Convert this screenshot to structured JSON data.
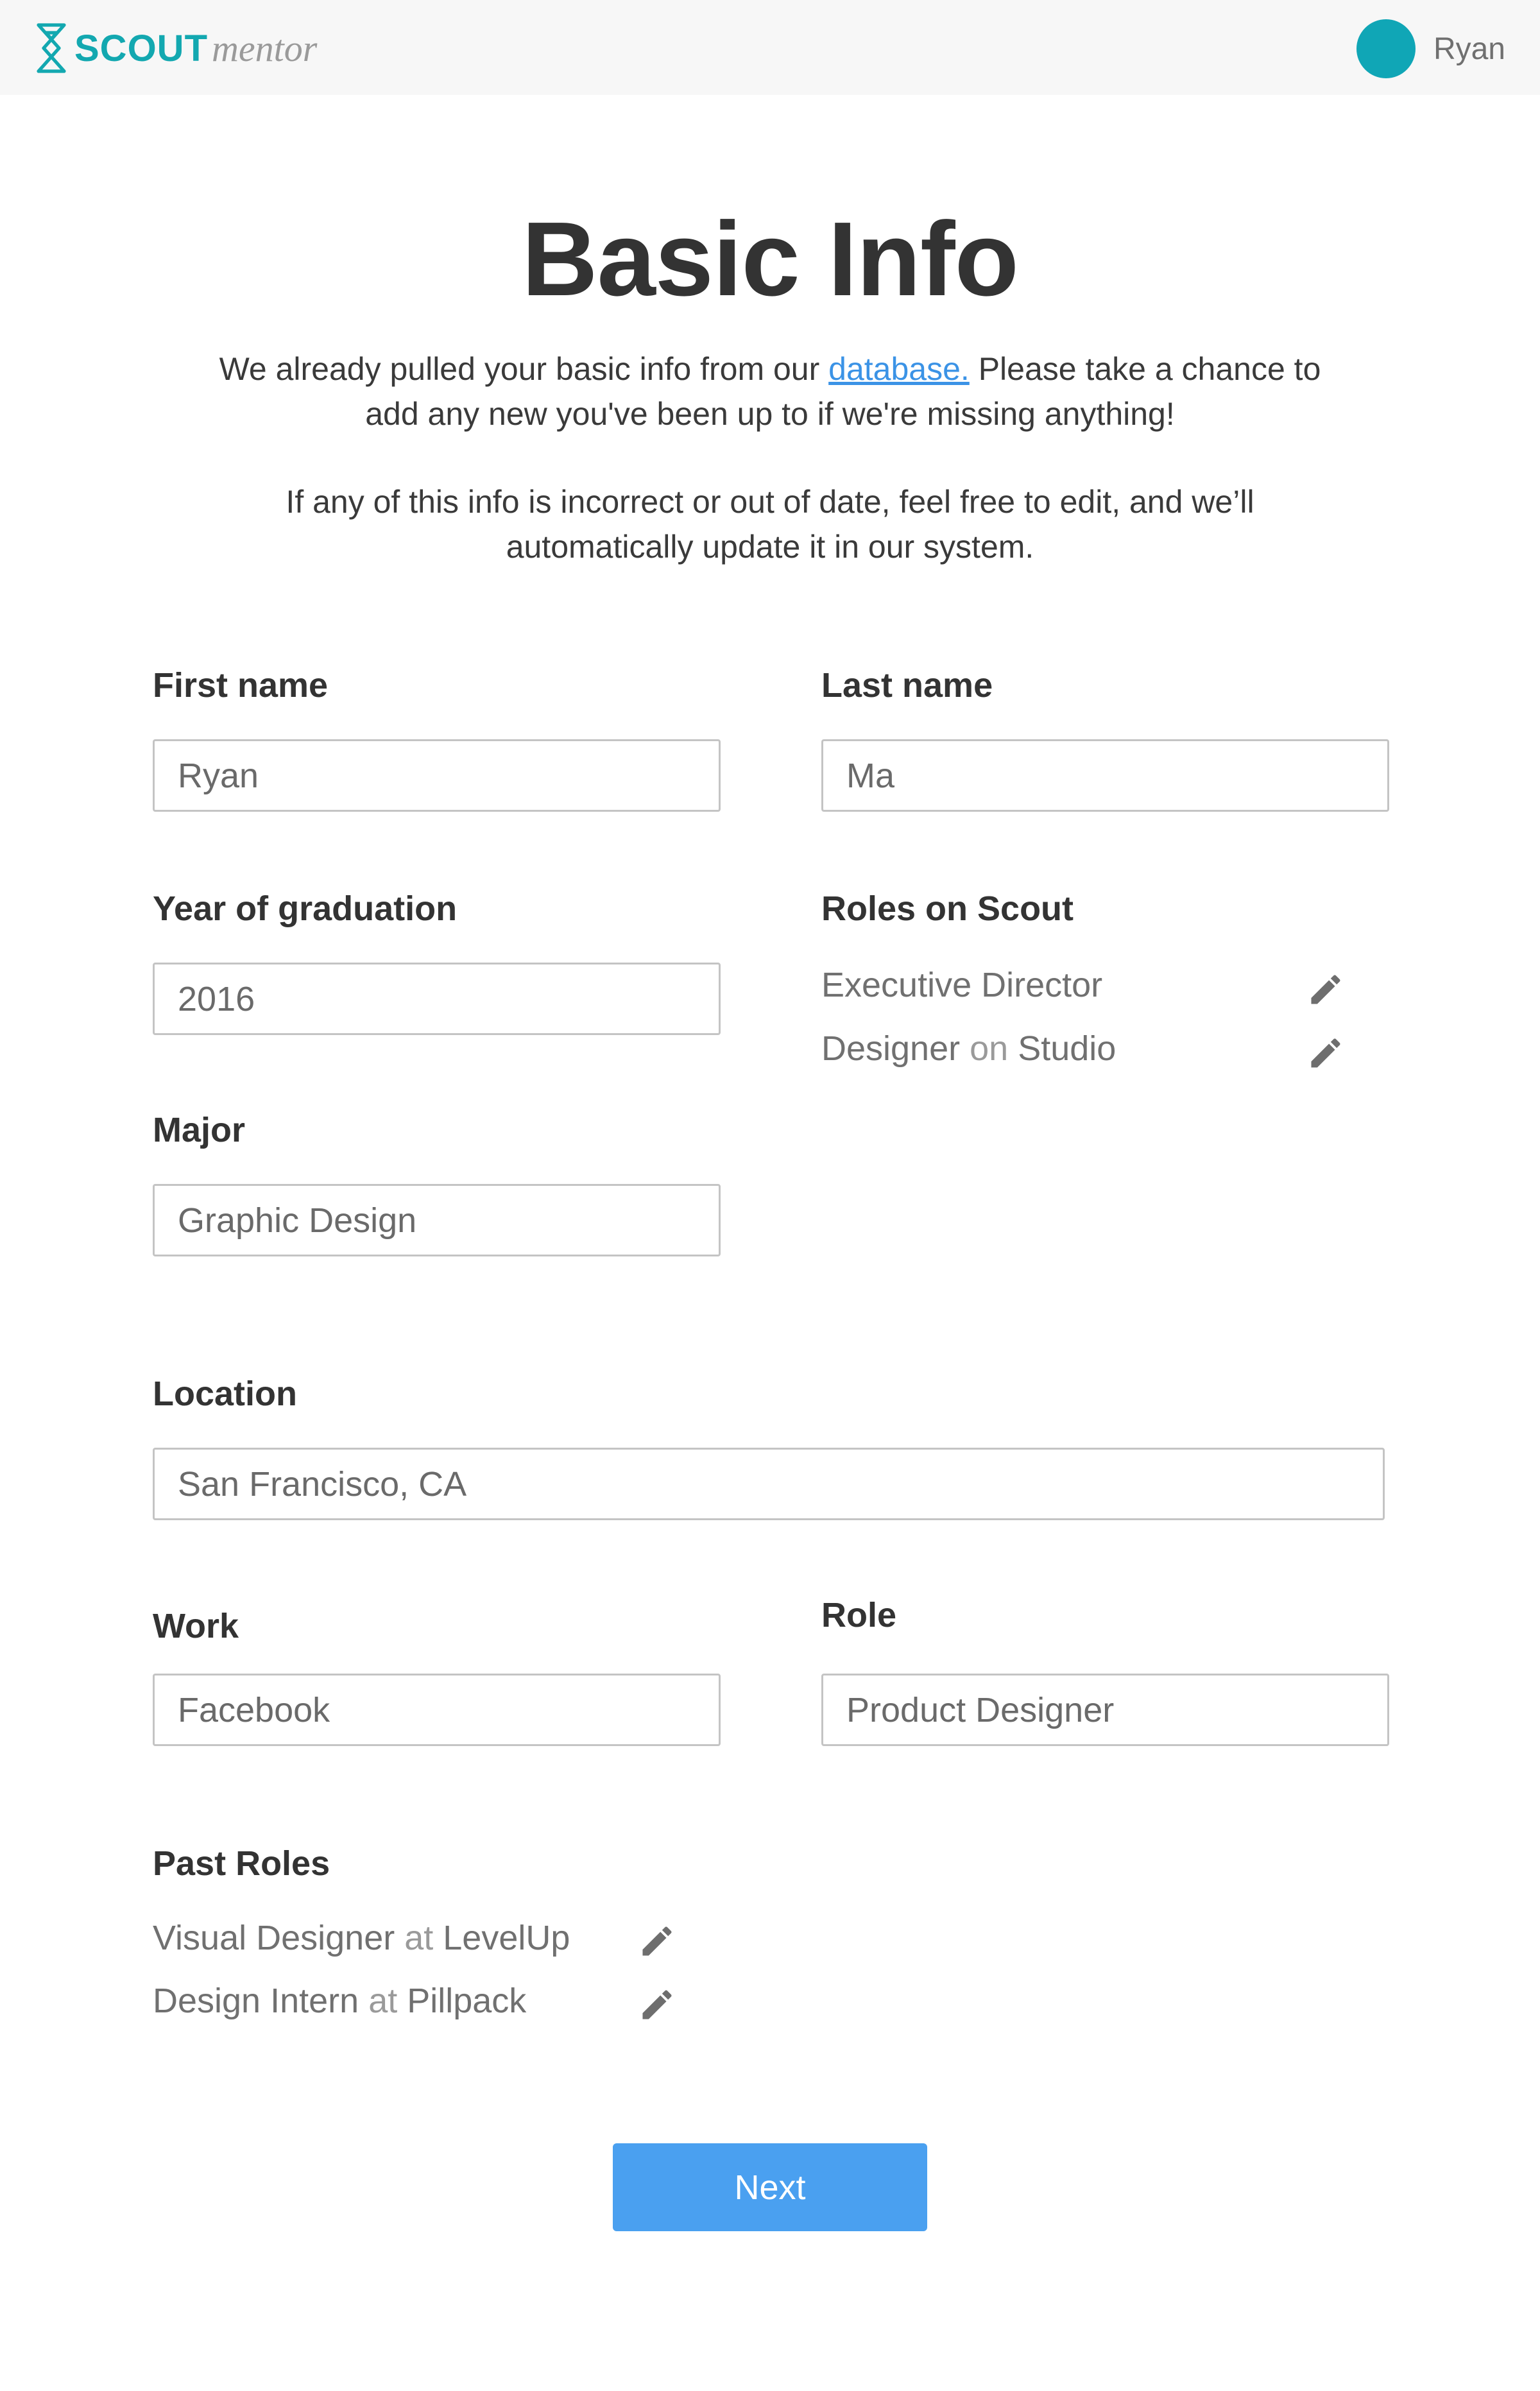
{
  "header": {
    "logo_primary": "SCOUT",
    "logo_secondary": "mentor",
    "user_name": "Ryan",
    "accent_color": "#13a8b0"
  },
  "main": {
    "title": "Basic Info",
    "intro_before_link": "We already pulled your basic info from our ",
    "intro_link": "database.",
    "intro_after_link": " Please take a chance to add any new you've been up to if we're missing anything!",
    "intro_second": "If any of this info is incorrect or out of date, feel free to edit, and we’ll automatically update it in our system."
  },
  "form": {
    "first_name": {
      "label": "First name",
      "value": "Ryan"
    },
    "last_name": {
      "label": "Last name",
      "value": "Ma"
    },
    "graduation": {
      "label": "Year of graduation",
      "value": "2016"
    },
    "major": {
      "label": "Major",
      "value": "Graphic Design"
    },
    "location": {
      "label": "Location",
      "value": "San Francisco, CA"
    },
    "work": {
      "label": "Work",
      "value": "Facebook"
    },
    "role": {
      "label": "Role",
      "value": "Product Designer"
    },
    "roles_on_scout": {
      "label": "Roles on Scout",
      "items": [
        {
          "title": "Executive Director",
          "conj": "",
          "org": ""
        },
        {
          "title": "Designer",
          "conj": " on ",
          "org": "Studio"
        }
      ]
    },
    "past_roles": {
      "label": "Past Roles",
      "items": [
        {
          "title": "Visual Designer",
          "conj": " at ",
          "org": "LevelUp"
        },
        {
          "title": "Design Intern",
          "conj": " at ",
          "org": "Pillpack"
        }
      ]
    },
    "next_button": "Next",
    "button_color": "#4aa0f0",
    "link_color": "#3b93e6"
  }
}
